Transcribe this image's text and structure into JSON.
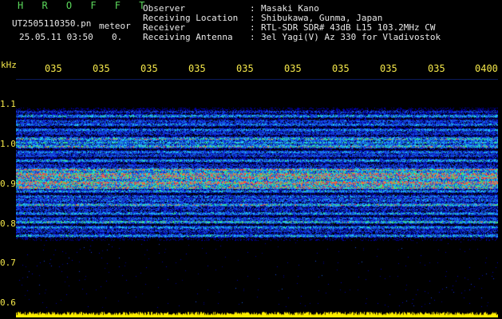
{
  "header_left": {
    "brand": "H R O F F T",
    "filename": "UT2505110350.pn",
    "tag": "meteor",
    "datetime": "25.05.11 03:50",
    "counter": "0."
  },
  "info": [
    {
      "label": "Observer",
      "value": "Masaki Kano"
    },
    {
      "label": "Receiving Location",
      "value": "Shibukawa, Gunma, Japan"
    },
    {
      "label": "Receiver",
      "value": "RTL-SDR SDR# 43dB L15 103.2MHz CW"
    },
    {
      "label": "Receiving Antenna",
      "value": "3el Yagi(V) Az 330 for Vladivostok"
    }
  ],
  "separator": ":",
  "y_axis": {
    "unit": "kHz",
    "ticks": [
      "1.1",
      "1.0",
      "0.9",
      "0.8",
      "0.7",
      "0.6"
    ]
  },
  "x_axis": {
    "ticks": [
      "035",
      "035",
      "035",
      "035",
      "035",
      "035",
      "035",
      "035",
      "035",
      "0400"
    ]
  },
  "colors": {
    "background": "#000000",
    "header_green": "#5bd85b",
    "header_white": "#e8e8e8",
    "tick_yellow": "#f5e84a",
    "signal_blue": "#1c3cff",
    "signal_cyan": "#27d7ff",
    "signal_green": "#3bf06a",
    "signal_red": "#ff3b3b",
    "power_yellow": "#ffee00"
  },
  "spectrogram": {
    "y_range_khz": [
      0.6,
      1.1
    ],
    "signal_band_khz": [
      0.76,
      1.04
    ],
    "strong_band_khz": [
      0.87,
      0.91
    ],
    "baseline_level": 0.6
  }
}
